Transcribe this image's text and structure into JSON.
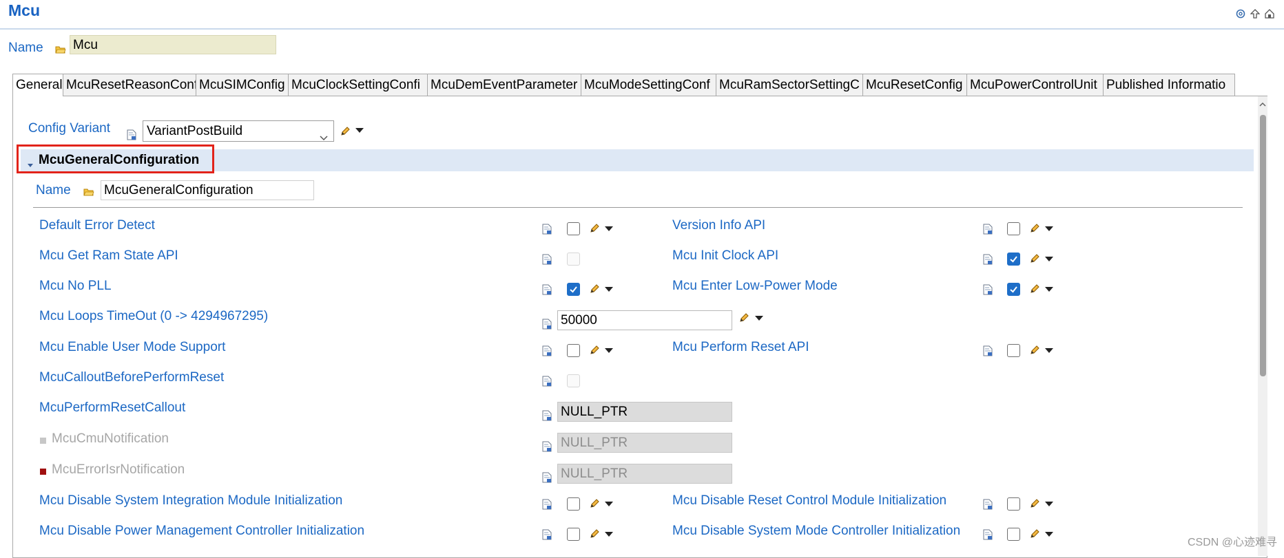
{
  "window": {
    "title": "Mcu"
  },
  "name_row": {
    "label": "Name",
    "value": "Mcu"
  },
  "tabs": [
    {
      "label": "General",
      "active": true
    },
    {
      "label": "McuResetReasonConf"
    },
    {
      "label": "McuSIMConfig"
    },
    {
      "label": "McuClockSettingConfi"
    },
    {
      "label": "McuDemEventParameter"
    },
    {
      "label": "McuModeSettingConf"
    },
    {
      "label": "McuRamSectorSettingC"
    },
    {
      "label": "McuResetConfig"
    },
    {
      "label": "McuPowerControlUnit"
    },
    {
      "label": "Published Informatio"
    }
  ],
  "config_variant": {
    "label": "Config Variant",
    "value": "VariantPostBuild"
  },
  "section": {
    "title": "McuGeneralConfiguration",
    "name_label": "Name",
    "name_value": "McuGeneralConfiguration"
  },
  "params_left": [
    {
      "label": "Default Error Detect",
      "control": "checkbox",
      "checked": false
    },
    {
      "label": "Mcu Get Ram State API",
      "control": "checkbox",
      "checked": false,
      "disabled": true
    },
    {
      "label": "Mcu No PLL",
      "control": "checkbox",
      "checked": true
    },
    {
      "label": "Mcu Loops TimeOut (0 -> 4294967295)",
      "control": "text",
      "value": "50000"
    },
    {
      "label": "Mcu Enable User Mode Support",
      "control": "checkbox",
      "checked": false
    },
    {
      "label": "McuCalloutBeforePerformReset",
      "control": "checkbox",
      "checked": false,
      "disabled": true
    },
    {
      "label": "McuPerformResetCallout",
      "control": "text",
      "value": "NULL_PTR",
      "readonly": true
    },
    {
      "label": "McuCmuNotification",
      "control": "text",
      "value": "NULL_PTR",
      "readonly": true,
      "inactive": true,
      "marker_color": "#c7c7c7"
    },
    {
      "label": "McuErrorIsrNotification",
      "control": "text",
      "value": "NULL_PTR",
      "readonly": true,
      "inactive": true,
      "marker_color": "#a01010"
    },
    {
      "label": "Mcu Disable System Integration Module Initialization",
      "control": "checkbox",
      "checked": false
    },
    {
      "label": "Mcu Disable Power Management Controller Initialization",
      "control": "checkbox",
      "checked": false
    }
  ],
  "params_right": [
    {
      "label": "Version Info API",
      "checked": false
    },
    {
      "label": "Mcu Init Clock API",
      "checked": true
    },
    {
      "label": "Mcu Enter Low-Power Mode",
      "checked": true
    },
    {
      "label": "Mcu Perform Reset API",
      "checked": false
    },
    {
      "label": "Mcu Disable Reset Control Module Initialization",
      "checked": false
    },
    {
      "label": "Mcu Disable System Mode Controller Initialization",
      "checked": false
    }
  ],
  "watermark": "CSDN @心迹难寻",
  "colors": {
    "link": "#1c68c4",
    "accent": "#1e6ec8",
    "highlight": "#e2231a"
  },
  "icons": [
    "at-icon",
    "up-arrow-icon",
    "home-icon",
    "folder-icon",
    "param-doc-icon",
    "pencil-icon",
    "dropdown-arrow-icon",
    "checkmark-icon"
  ]
}
